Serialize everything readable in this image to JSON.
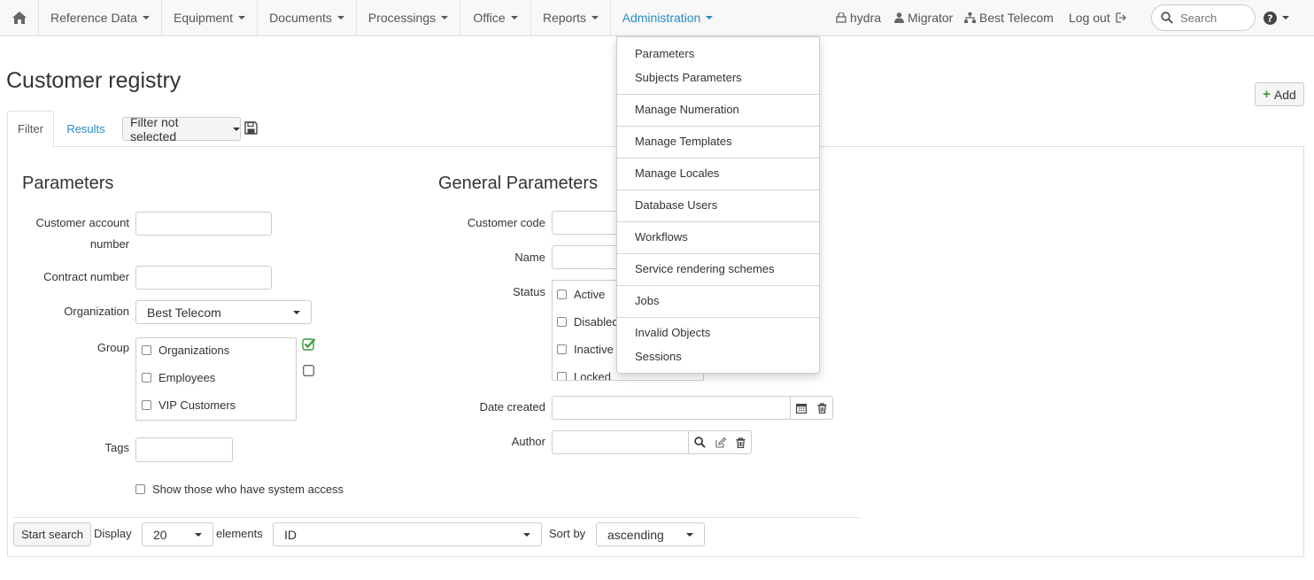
{
  "nav": {
    "home_icon": "home-icon",
    "items": [
      {
        "label": "Reference Data"
      },
      {
        "label": "Equipment"
      },
      {
        "label": "Documents"
      },
      {
        "label": "Processings"
      },
      {
        "label": "Office"
      },
      {
        "label": "Reports"
      },
      {
        "label": "Administration"
      }
    ],
    "db_label": "hydra",
    "user_label": "Migrator",
    "org_label": "Best Telecom",
    "logout_label": "Log out",
    "search_placeholder": "Search"
  },
  "page": {
    "title": "Customer registry",
    "add_label": "Add"
  },
  "tabs": {
    "filter": "Filter",
    "results": "Results",
    "filter_select": "Filter not selected"
  },
  "params": {
    "title": "Parameters",
    "account_label_1": "Customer account",
    "account_label_2": "number",
    "contract_label": "Contract number",
    "organization_label": "Organization",
    "organization_value": "Best Telecom",
    "group_label": "Group",
    "group_options": [
      "Organizations",
      "Employees",
      "VIP Customers"
    ],
    "tags_label": "Tags",
    "system_access_label": "Show those who have system access"
  },
  "general": {
    "title": "General Parameters",
    "code_label": "Customer code",
    "name_label": "Name",
    "status_label": "Status",
    "status_options": [
      "Active",
      "Disabled",
      "Inactive",
      "Locked"
    ],
    "date_label": "Date created",
    "author_label": "Author"
  },
  "footer": {
    "search_btn": "Start search",
    "display_label": "Display",
    "display_value": "20",
    "elements_label": "elements",
    "sort_field": "ID",
    "sort_by_label": "Sort by",
    "sort_order": "ascending"
  },
  "admin_menu": {
    "items": [
      "Parameters",
      "Subjects Parameters",
      "Manage Numeration",
      "Manage Templates",
      "Manage Locales",
      "Database Users",
      "Workflows",
      "Service rendering schemes",
      "Jobs",
      "Invalid Objects",
      "Sessions"
    ]
  },
  "colors": {
    "accent": "#2a8ac4",
    "check_green": "#3c9a3c"
  }
}
